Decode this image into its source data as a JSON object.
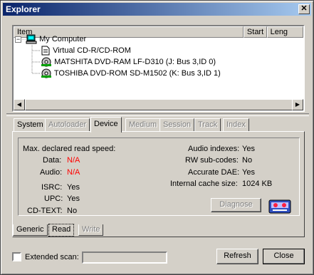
{
  "window": {
    "title": "Explorer",
    "close_glyph": "✕"
  },
  "columns": [
    "Item",
    "Start",
    "Leng"
  ],
  "tree": {
    "root": "My Computer",
    "items": [
      "Virtual CD-R/CD-ROM",
      "MATSHITA DVD-RAM LF-D310 (J: Bus 3,ID 0)",
      "TOSHIBA DVD-ROM SD-M1502 (K: Bus 3,ID 1)"
    ],
    "expander": "−"
  },
  "tabs": [
    {
      "label": "System",
      "enabled": true
    },
    {
      "label": "Autoloader",
      "enabled": false
    },
    {
      "label": "Device",
      "enabled": true,
      "active": true
    },
    {
      "label": "Medium",
      "enabled": false
    },
    {
      "label": "Session",
      "enabled": false
    },
    {
      "label": "Track",
      "enabled": false
    },
    {
      "label": "Index",
      "enabled": false
    }
  ],
  "device": {
    "max_read_speed_label": "Max. declared read speed:",
    "data_label": "Data:",
    "data_value": "N/A",
    "audio_label": "Audio:",
    "audio_value": "N/A",
    "isrc_label": "ISRC:",
    "isrc_value": "Yes",
    "upc_label": "UPC:",
    "upc_value": "Yes",
    "cdtext_label": "CD-TEXT:",
    "cdtext_value": "No",
    "audio_indexes_label": "Audio indexes:",
    "audio_indexes_value": "Yes",
    "rw_subcodes_label": "RW sub-codes:",
    "rw_subcodes_value": "No",
    "accurate_dae_label": "Accurate DAE:",
    "accurate_dae_value": "Yes",
    "cache_label": "Internal cache size:",
    "cache_value": "1024 KB",
    "diagnose_label": "Diagnose"
  },
  "bottom_tabs": [
    {
      "label": "Generic",
      "enabled": true
    },
    {
      "label": "Read",
      "enabled": true,
      "active": true
    },
    {
      "label": "Write",
      "enabled": false
    }
  ],
  "extended_scan_label": "Extended scan:",
  "refresh_label": "Refresh",
  "close_label": "Close",
  "colors": {
    "title_start": "#0a246a",
    "title_end": "#a6caf0",
    "na_red": "#ff0000",
    "face": "#d4d0c8"
  }
}
